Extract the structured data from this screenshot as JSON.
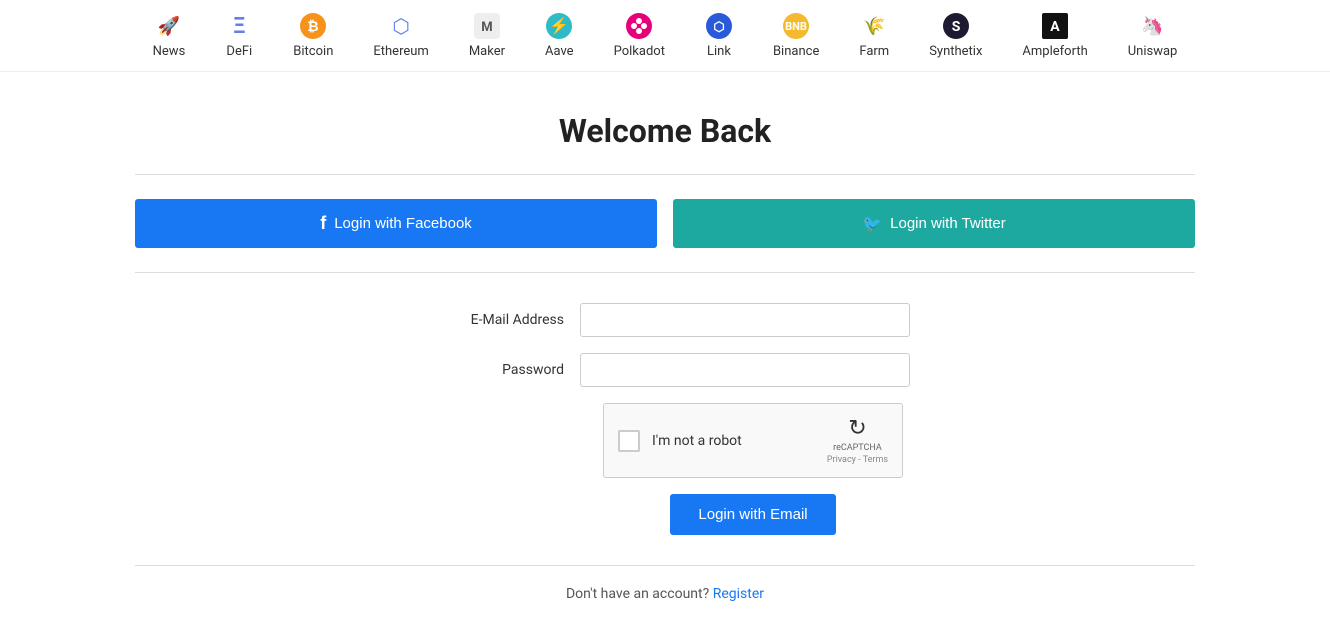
{
  "nav": {
    "items": [
      {
        "id": "news",
        "label": "News",
        "icon": "🚀",
        "icon_type": "emoji"
      },
      {
        "id": "defi",
        "label": "DeFi",
        "icon": "Ξ",
        "icon_type": "text",
        "color": "#627EEA"
      },
      {
        "id": "bitcoin",
        "label": "Bitcoin",
        "icon": "₿",
        "icon_type": "text",
        "color": "#F7931A"
      },
      {
        "id": "ethereum",
        "label": "Ethereum",
        "icon": "⟠",
        "icon_type": "text",
        "color": "#627EEA"
      },
      {
        "id": "maker",
        "label": "Maker",
        "icon": "M",
        "icon_type": "text",
        "color": "#aaa"
      },
      {
        "id": "aave",
        "label": "Aave",
        "icon": "⚡",
        "icon_type": "emoji",
        "color": "#B6509E"
      },
      {
        "id": "polkadot",
        "label": "Polkadot",
        "icon": "𝗣",
        "icon_type": "text",
        "color": "#E6007A"
      },
      {
        "id": "link",
        "label": "Link",
        "icon": "◈",
        "icon_type": "text",
        "color": "#2A5ADA"
      },
      {
        "id": "binance",
        "label": "Binance",
        "icon": "◆",
        "icon_type": "text",
        "color": "#F3BA2F"
      },
      {
        "id": "farm",
        "label": "Farm",
        "icon": "🌾",
        "icon_type": "emoji"
      },
      {
        "id": "synthetix",
        "label": "Synthetix",
        "icon": "S",
        "icon_type": "circle",
        "color": "#1E1A31"
      },
      {
        "id": "ampleforth",
        "label": "Ampleforth",
        "icon": "A",
        "icon_type": "text",
        "color": "#1a1a1a"
      },
      {
        "id": "uniswap",
        "label": "Uniswap",
        "icon": "🦄",
        "icon_type": "emoji"
      }
    ]
  },
  "page": {
    "title": "Welcome Back"
  },
  "social": {
    "facebook_label": "Login with Facebook",
    "facebook_icon": "f",
    "twitter_label": "Login with Twitter",
    "twitter_icon": "🐦"
  },
  "form": {
    "email_label": "E-Mail Address",
    "email_placeholder": "",
    "password_label": "Password",
    "password_placeholder": "",
    "captcha_label": "I'm not a robot",
    "captcha_brand": "reCAPTCHA",
    "captcha_sub": "Privacy - Terms",
    "login_btn": "Login with Email"
  },
  "footer": {
    "no_account": "Don't have an account?",
    "register_label": "Register"
  }
}
